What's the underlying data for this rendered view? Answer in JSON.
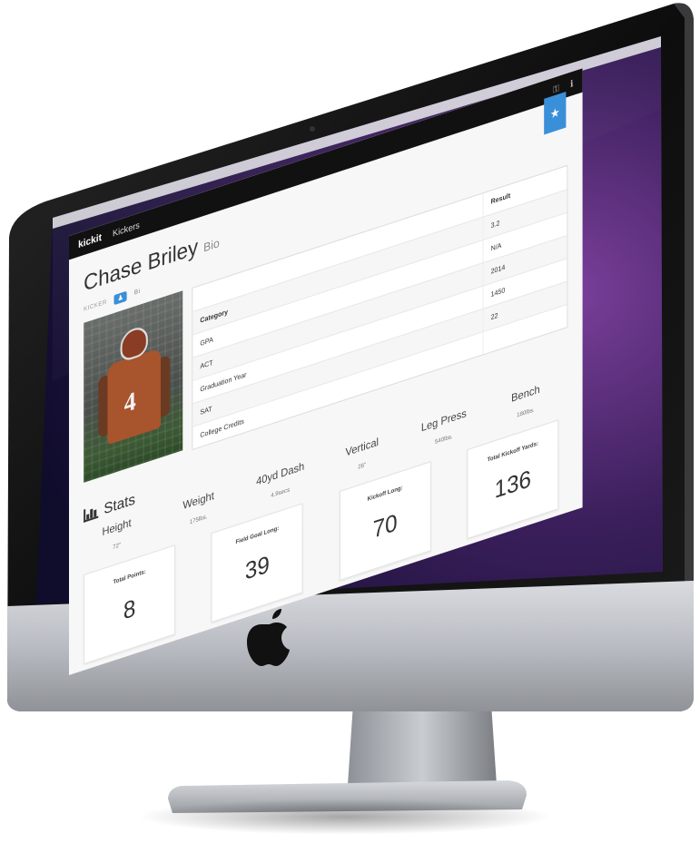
{
  "app": {
    "logo_text": "kickit",
    "nav_label": "Kickers"
  },
  "profile": {
    "name": "Chase Briley",
    "name_suffix": "Bio",
    "position_label": "KICKER",
    "tab_icon_glyph": "♟",
    "tab2_label": "Bi",
    "photo_jersey_number": "4"
  },
  "bio_table": {
    "headers": [
      "",
      "Result"
    ],
    "rows": [
      {
        "category": "Category",
        "result": "3.2"
      },
      {
        "category": "GPA",
        "result": "N/A"
      },
      {
        "category": "ACT",
        "result": "2014"
      },
      {
        "category": "Graduation Year",
        "result": "1450"
      },
      {
        "category": "SAT",
        "result": "22"
      },
      {
        "category": "College Credits",
        "result": ""
      }
    ]
  },
  "stats": {
    "title": "Stats",
    "items": [
      {
        "label": "Height",
        "value": "72\""
      },
      {
        "label": "Weight",
        "value": "175lbs."
      },
      {
        "label": "40yd Dash",
        "value": "4.9secs"
      },
      {
        "label": "Vertical",
        "value": "26\""
      },
      {
        "label": "Leg Press",
        "value": "540lbs."
      },
      {
        "label": "Bench",
        "value": "180lbs."
      }
    ]
  },
  "cards": [
    {
      "label": "Total Points:",
      "value": "8"
    },
    {
      "label": "Field Goal Long:",
      "value": "39"
    },
    {
      "label": "Kickoff Long:",
      "value": "70"
    },
    {
      "label": "Total Kickoff Yards:",
      "value": "136"
    }
  ],
  "colors": {
    "accent": "#3a8fd9",
    "topbar": "#111111",
    "desktop_purple": "#5a2d72"
  },
  "icons": {
    "favorite": "star-icon",
    "stats": "bar-chart-icon",
    "brand": "apple-logo-icon"
  }
}
